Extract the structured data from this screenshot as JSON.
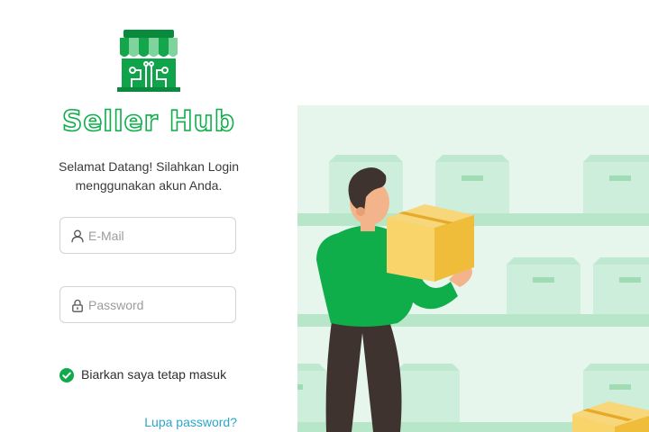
{
  "brand": {
    "name": "Seller Hub",
    "color": "#0fae4b"
  },
  "welcome": {
    "line1": "Selamat Datang! Silahkan Login",
    "line2": "menggunakan akun Anda."
  },
  "form": {
    "email_placeholder": "E-Mail",
    "email_icon": "user-icon",
    "password_placeholder": "Password",
    "password_icon": "lock-icon",
    "remember_label": "Biarkan saya tetap masuk",
    "remember_checked": true,
    "forgot_label": "Lupa password?"
  },
  "colors": {
    "accent": "#10a94c",
    "link": "#2aa7c9",
    "illustration_bg": "#e6f6ec"
  }
}
